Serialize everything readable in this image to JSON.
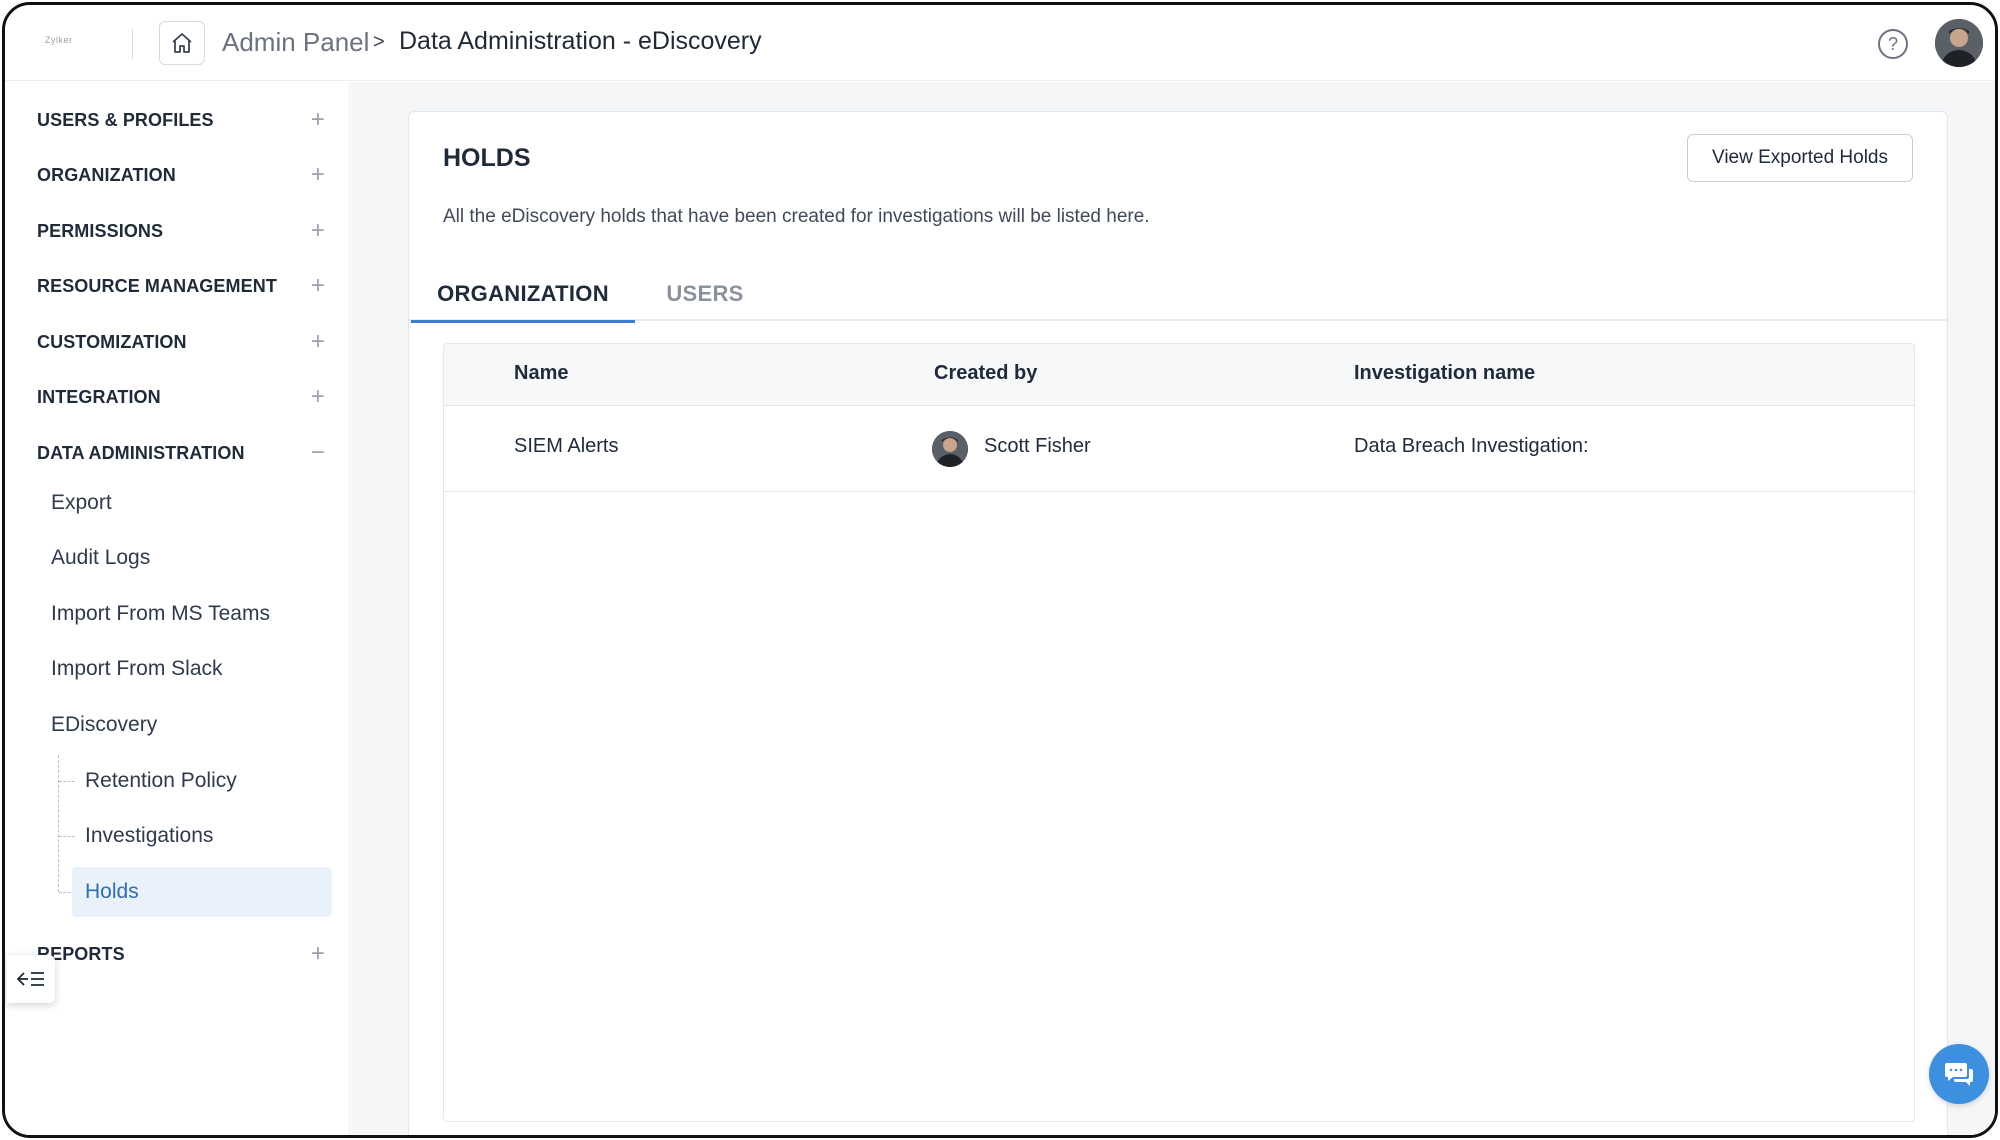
{
  "header": {
    "logo_text": "Zylker",
    "breadcrumb_root": "Admin Panel",
    "breadcrumb_separator": ">",
    "breadcrumb_current": "Data Administration - eDiscovery",
    "help_symbol": "?"
  },
  "sidebar": {
    "sections": [
      {
        "label": "USERS & PROFILES",
        "toggle": "+"
      },
      {
        "label": "ORGANIZATION",
        "toggle": "+"
      },
      {
        "label": "PERMISSIONS",
        "toggle": "+"
      },
      {
        "label": "RESOURCE MANAGEMENT",
        "toggle": "+"
      },
      {
        "label": "CUSTOMIZATION",
        "toggle": "+"
      },
      {
        "label": "INTEGRATION",
        "toggle": "+"
      },
      {
        "label": "DATA ADMINISTRATION",
        "toggle": "−"
      },
      {
        "label": "REPORTS",
        "toggle": "+"
      }
    ],
    "data_admin_items": [
      "Export",
      "Audit Logs",
      "Import From MS Teams",
      "Import From Slack",
      "EDiscovery"
    ],
    "ediscovery_items": [
      "Retention Policy",
      "Investigations",
      "Holds"
    ],
    "active_item": "Holds",
    "collapse_icon": "collapse-sidebar-icon"
  },
  "main": {
    "title": "HOLDS",
    "description": "All the eDiscovery holds that have been created for investigations will be listed here.",
    "export_button": "View Exported Holds",
    "tabs": [
      {
        "label": "ORGANIZATION",
        "active": true
      },
      {
        "label": "USERS",
        "active": false
      }
    ],
    "table": {
      "columns": [
        "Name",
        "Created by",
        "Investigation name"
      ],
      "rows": [
        {
          "name": "SIEM Alerts",
          "created_by": "Scott Fisher",
          "investigation": "Data Breach Investigation:"
        }
      ]
    }
  },
  "colors": {
    "accent": "#3a7bd5",
    "active_bg": "#e9f1fb",
    "chat_button": "#3d8fe0"
  }
}
